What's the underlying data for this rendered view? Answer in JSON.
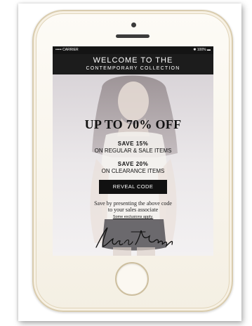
{
  "status_bar": {
    "carrier": "••••• CARRIER",
    "battery": "✱ 100% ▬"
  },
  "header": {
    "line1": "WELCOME TO THE",
    "line2": "CONTEMPORARY COLLECTION"
  },
  "promo": {
    "headline": "UP TO 70% OFF",
    "offer1_title": "SAVE 15%",
    "offer1_detail": "ON REGULAR & SALE ITEMS",
    "offer2_title": "SAVE 20%",
    "offer2_detail": "ON CLEARANCE ITEMS",
    "reveal_button": "REVEAL CODE",
    "present_line1": "Save by presenting the above code",
    "present_line2": "to your sales associate",
    "exclusions_link": "Some exclusions apply.",
    "signature": "Lord & Taylor"
  },
  "colors": {
    "header_bg": "#1c1c1c",
    "button_bg": "#111111",
    "phone_body": "#f7f2e6",
    "phone_trim": "#d9ccae"
  }
}
